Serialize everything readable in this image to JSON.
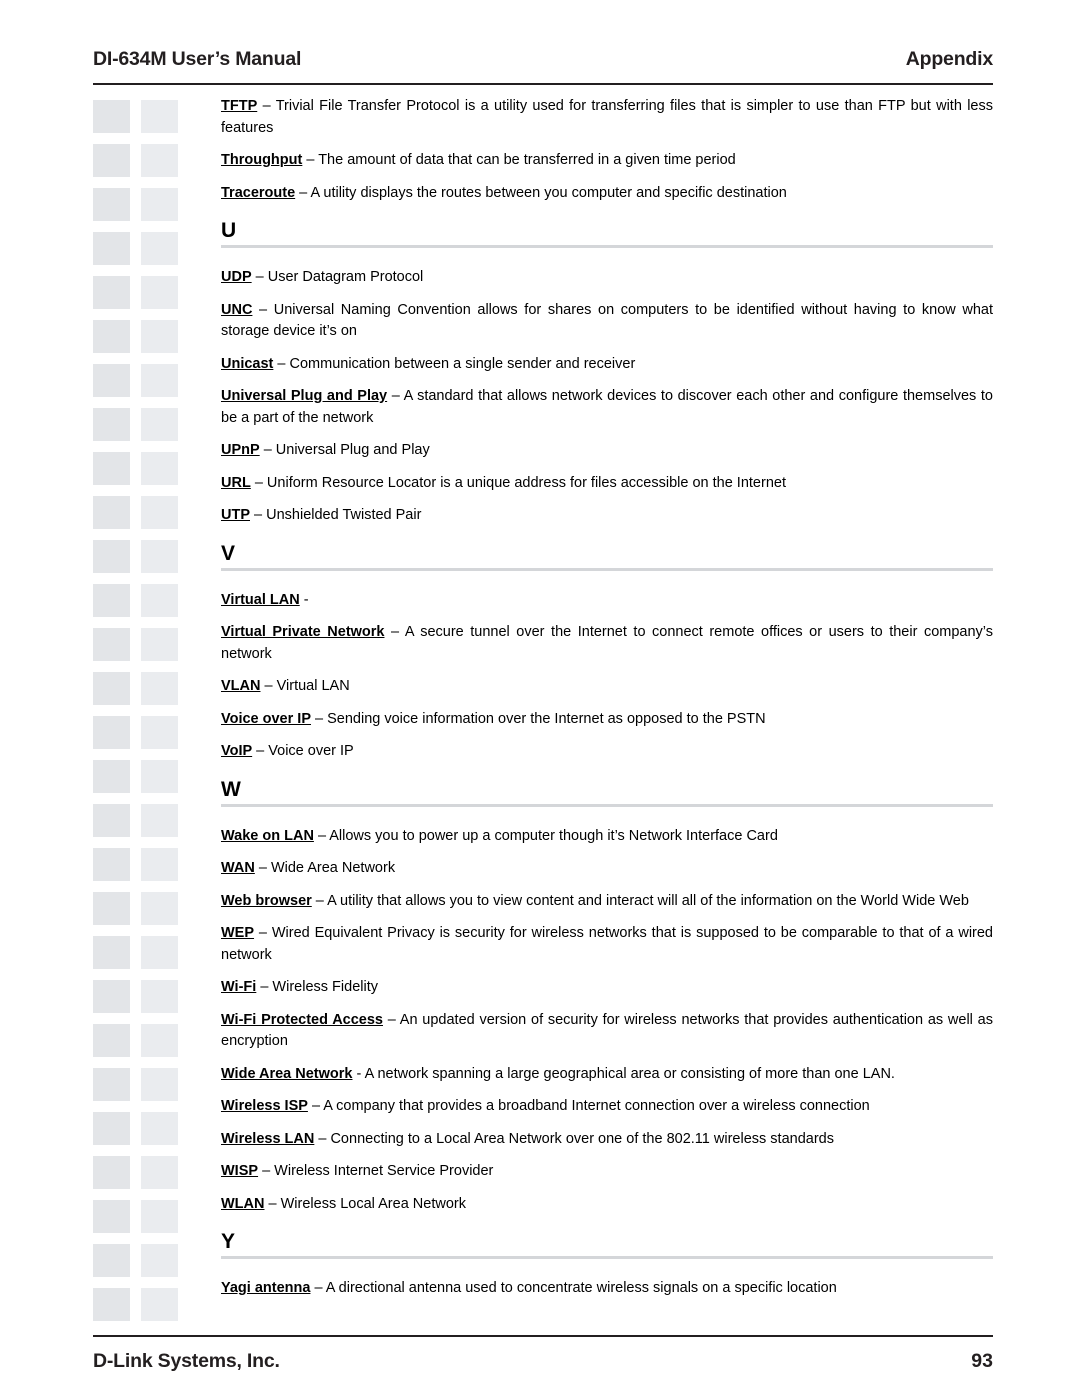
{
  "header": {
    "title": "DI-634M User’s Manual",
    "section": "Appendix"
  },
  "footer": {
    "company": "D-Link Systems, Inc.",
    "page_number": "93"
  },
  "glossary": {
    "top_entries": [
      {
        "term": "TFTP",
        "definition": " – Trivial File Transfer Protocol is a utility used for transferring files that is simpler to use than FTP but with less features"
      },
      {
        "term": "Throughput",
        "definition": " – The amount of data that can be transferred in a given time period"
      },
      {
        "term": "Traceroute",
        "definition": " – A utility displays the routes between you computer and specific destination"
      }
    ],
    "sections": [
      {
        "letter": "U",
        "entries": [
          {
            "term": "UDP",
            "definition": " – User Datagram Protocol"
          },
          {
            "term": "UNC",
            "definition": " – Universal Naming Convention allows for shares on computers to be identified without having to know what storage device it’s on"
          },
          {
            "term": "Unicast",
            "definition": " – Communication between a single sender and receiver"
          },
          {
            "term": "Universal Plug and Play",
            "definition": " – A standard that allows network devices to discover each other and configure themselves to be a part of the network"
          },
          {
            "term": "UPnP",
            "definition": " – Universal Plug and Play"
          },
          {
            "term": "URL",
            "definition": " – Uniform Resource Locator is a unique address for files accessible on the Internet"
          },
          {
            "term": "UTP",
            "definition": " – Unshielded Twisted Pair"
          }
        ]
      },
      {
        "letter": "V",
        "entries": [
          {
            "term": "Virtual LAN",
            "definition": " -"
          },
          {
            "term": "Virtual Private Network",
            "definition": " – A secure tunnel over the Internet to connect remote offices or users to their company’s network"
          },
          {
            "term": "VLAN",
            "definition": " – Virtual LAN"
          },
          {
            "term": "Voice over IP",
            "definition": " – Sending voice information over the Internet as opposed to the PSTN"
          },
          {
            "term": "VoIP",
            "definition": " – Voice over IP"
          }
        ]
      },
      {
        "letter": "W",
        "entries": [
          {
            "term": "Wake on LAN",
            "definition": " – Allows you to power up a computer though it’s Network Interface Card"
          },
          {
            "term": "WAN",
            "definition": " – Wide Area Network"
          },
          {
            "term": "Web browser",
            "definition": " – A utility that allows you to view content and interact will all of the information on the World Wide Web"
          },
          {
            "term": "WEP",
            "definition": " – Wired Equivalent Privacy is security for wireless networks that is supposed  to be comparable to that of a wired network"
          },
          {
            "term": "Wi-Fi",
            "definition": " – Wireless Fidelity"
          },
          {
            "term": "Wi-Fi Protected Access",
            "definition": " – An updated version of security for wireless networks that provides authentication as well as encryption"
          },
          {
            "term": "Wide Area Network",
            "definition": " - A network spanning a large geographical area or consisting of more than one LAN."
          },
          {
            "term": "Wireless ISP",
            "definition": " – A company that provides a broadband Internet connection over a wireless connection"
          },
          {
            "term": "Wireless LAN",
            "definition": " – Connecting to a Local Area Network over one of the 802.11 wireless standards"
          },
          {
            "term": "WISP",
            "definition": " – Wireless Internet Service Provider"
          },
          {
            "term": "WLAN",
            "definition": " – Wireless Local Area Network"
          }
        ]
      },
      {
        "letter": "Y",
        "entries": [
          {
            "term": "Yagi antenna",
            "definition": " – A directional antenna used to concentrate wireless signals on a specific location"
          }
        ]
      }
    ]
  }
}
